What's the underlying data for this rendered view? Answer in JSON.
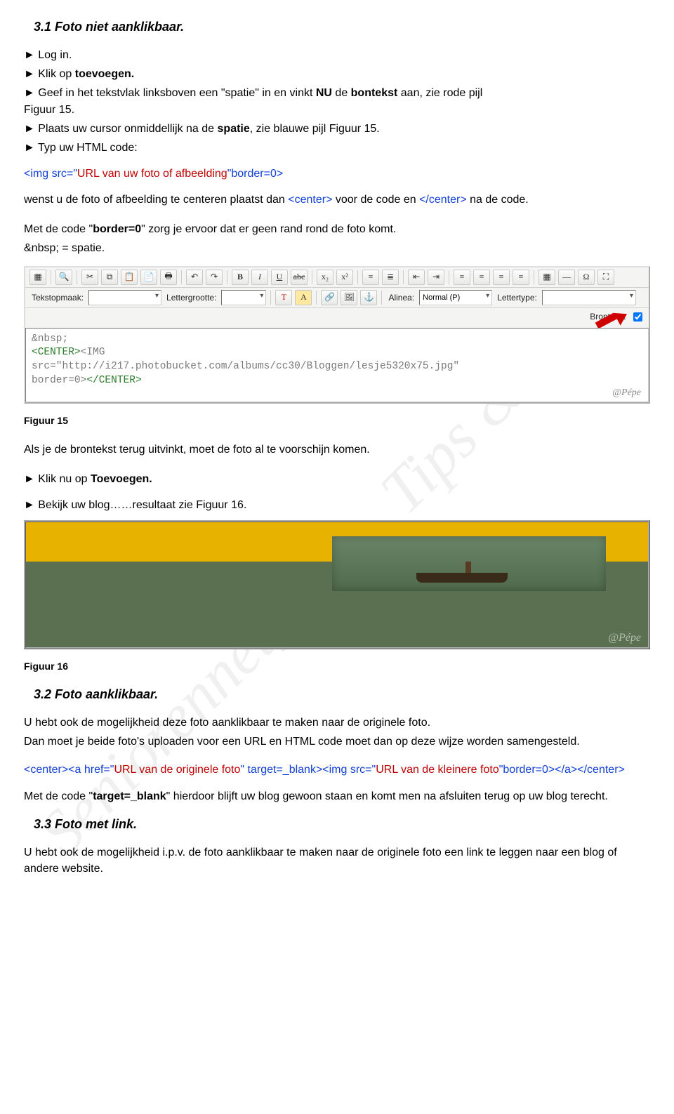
{
  "watermark": "Seniorennet_Blog_Tips & Trucs",
  "section31_title": "3.1 Foto niet aanklikbaar.",
  "section32_title": "3.2 Foto aanklikbaar.",
  "section33_title": "3.3 Foto met link.",
  "steps": {
    "s1": "Log in.",
    "s2_a": "Klik op ",
    "s2_b": "toevoegen.",
    "s3_a": "Geef in het tekstvlak linksboven een \"spatie\" in en vinkt ",
    "s3_b": "NU",
    "s3_c": " de ",
    "s3_d": "bontekst",
    "s3_e": " aan, zie rode pijl",
    "s3_f": "Figuur 15.",
    "s4_a": "Plaats uw cursor onmiddellijk na de ",
    "s4_b": "spatie",
    "s4_c": ", zie blauwe pijl Figuur 15.",
    "s5": "Typ uw HTML code:",
    "s6_a": "Klik nu op ",
    "s6_b": "Toevoegen.",
    "s7": "Bekijk uw blog……resultaat zie Figuur 16."
  },
  "code1": {
    "p1": "<img src=\"",
    "p2": "URL van uw foto of afbeelding",
    "p3": "\"border=0>"
  },
  "para_center_a": "wenst u de foto of afbeelding te centeren plaatst dan ",
  "para_center_b": "<center>",
  "para_center_c": " voor de code en ",
  "para_center_d": "</center>",
  "para_center_e": " na de code.",
  "para_border_a": "Met de code \"",
  "para_border_b": "border=0",
  "para_border_c": "\" zorg je ervoor dat er geen rand rond de foto komt.",
  "para_nbsp": "&nbsp; = spatie.",
  "fig15_caption": "Figuur 15",
  "fig16_caption": "Figuur 16",
  "fig15_text_after": "Als je de brontekst terug uitvinkt, moet de foto al te voorschijn komen.",
  "toolbar": {
    "row2_label1": "Tekstopmaak:",
    "row2_label2": "Lettergrootte:",
    "row2_label3": "Alinea:",
    "row2_sel_alinea": "Normal (P)",
    "row2_label4": "Lettertype:",
    "row3_label": "Brontekst"
  },
  "codebox": {
    "l1": "&nbsp;",
    "l2a": "<CENTER>",
    "l2b": "<IMG",
    "l3a": "src=\"http://i217.photobucket.com/albums/cc30/Bloggen/lesje5320x75.jpg\"",
    "l4a": "border=0>",
    "l4b": "</CENTER>",
    "credit": "@Pépe"
  },
  "para32_a": "U hebt ook de mogelijkheid deze foto aanklikbaar te maken naar de originele foto.",
  "para32_b": "Dan moet je beide foto's uploaden voor een URL en HTML code moet dan op deze wijze worden samengesteld.",
  "code2": {
    "p1": "<center><a href=\"",
    "p2": "URL van de originele foto",
    "p3": "\" target=_blank><img src=\"",
    "p4": "URL van de kleinere foto",
    "p5": "\"border=0></a></center>"
  },
  "para_target_a": "Met de code \"",
  "para_target_b": "target=_blank",
  "para_target_c": "\" hierdoor blijft uw blog gewoon staan en komt men na afsluiten terug op uw blog terecht.",
  "para33": "U hebt ook de mogelijkheid i.p.v. de foto aanklikbaar te maken naar de originele foto een link te leggen naar een blog of andere website.",
  "fig16_credit": "@Pépe"
}
